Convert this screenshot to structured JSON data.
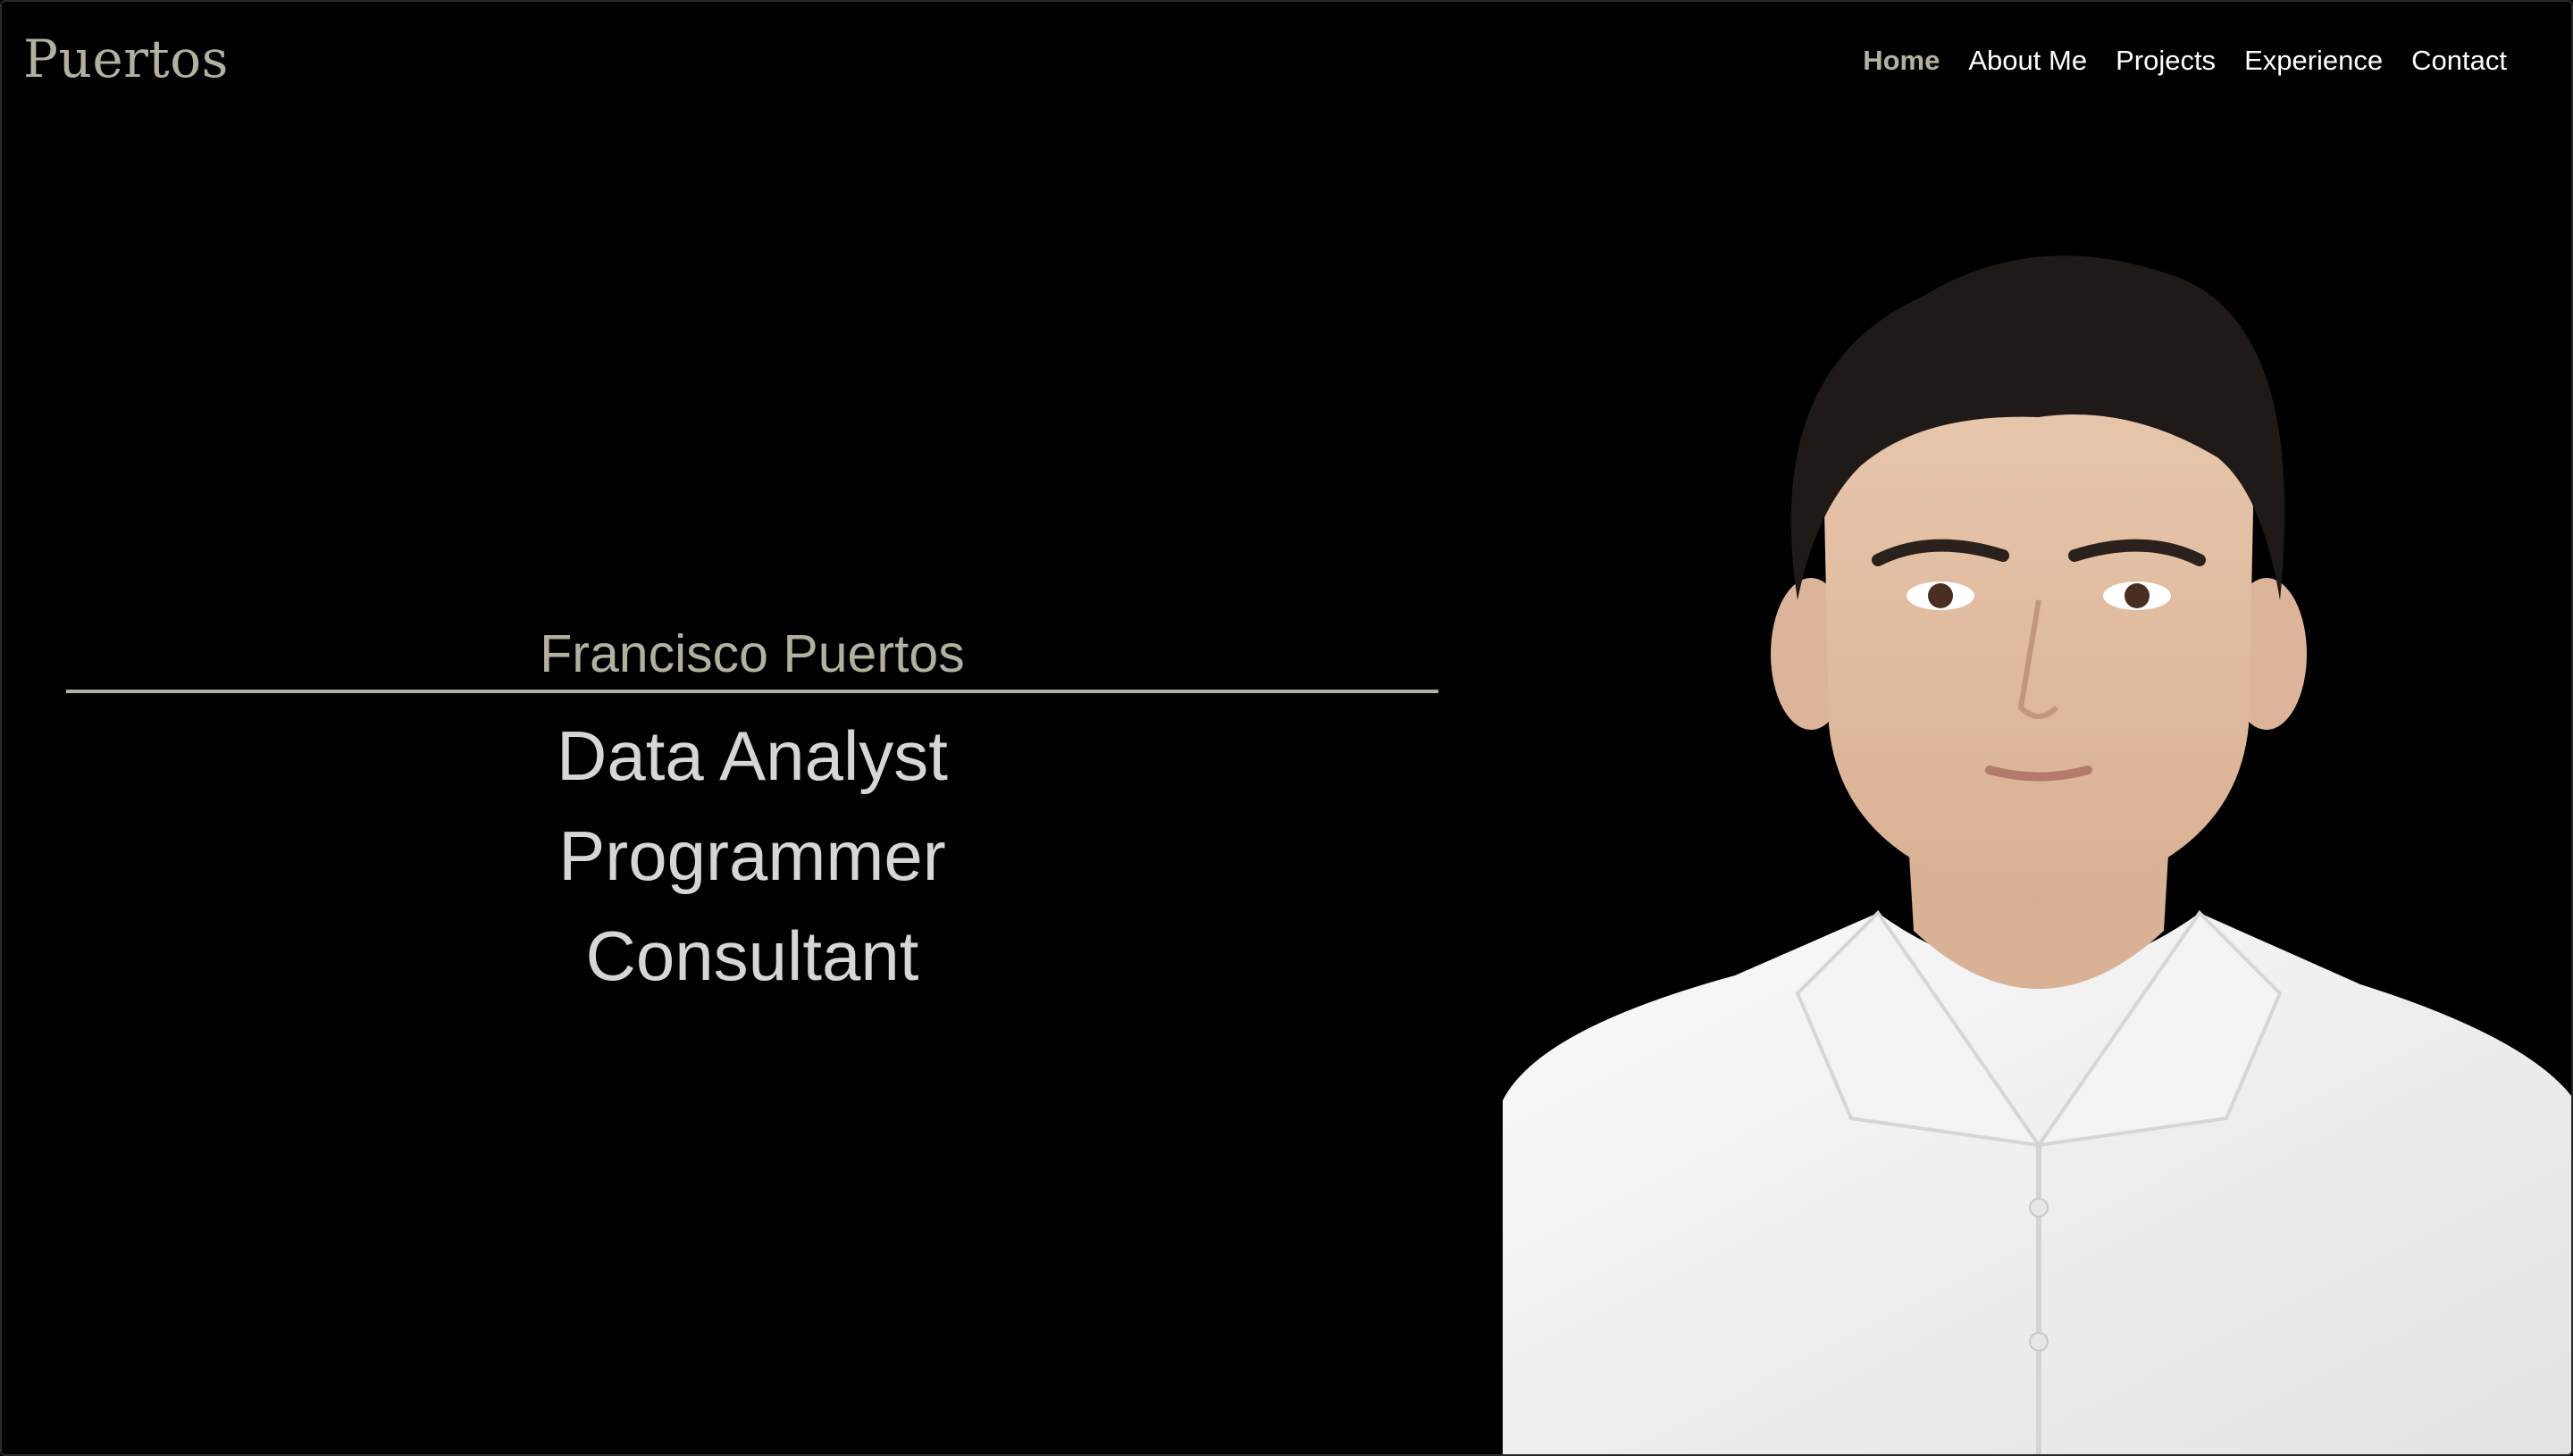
{
  "header": {
    "brand": "Puertos"
  },
  "nav": {
    "items": [
      {
        "label": "Home",
        "active": true
      },
      {
        "label": "About Me",
        "active": false
      },
      {
        "label": "Projects",
        "active": false
      },
      {
        "label": "Experience",
        "active": false
      },
      {
        "label": "Contact",
        "active": false
      }
    ]
  },
  "hero": {
    "name": "Francisco Puertos",
    "roles": [
      "Data Analyst",
      "Programmer",
      "Consultant"
    ]
  },
  "colors": {
    "background": "#000000",
    "accent": "#b3b09f",
    "role_text": "#d6d6d6",
    "nav_text": "#ffffff"
  },
  "icons": {
    "portrait": "portrait-photo"
  }
}
